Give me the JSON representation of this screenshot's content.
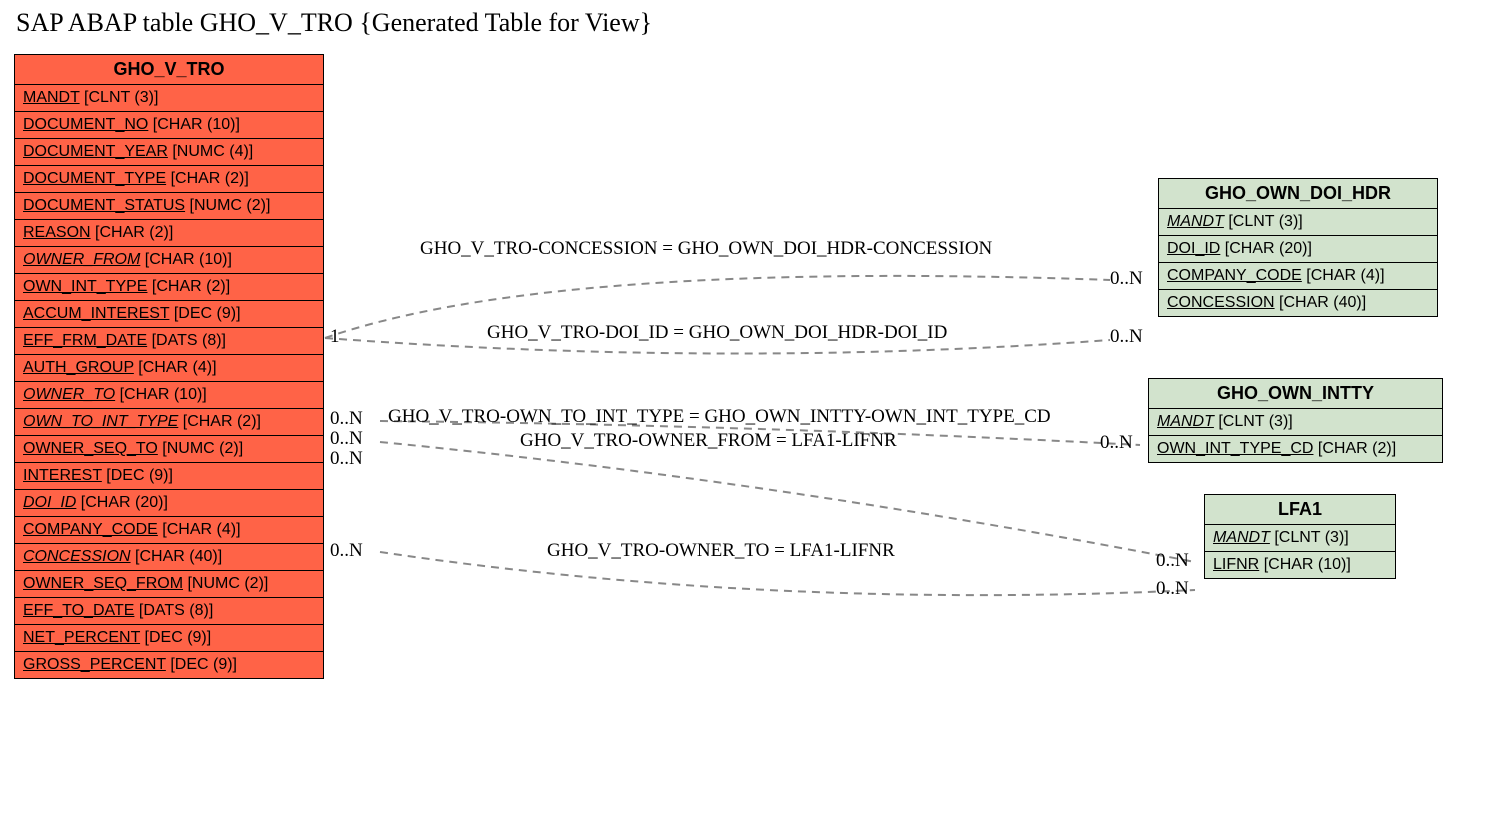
{
  "title": "SAP ABAP table GHO_V_TRO {Generated Table for View}",
  "entities": {
    "main": {
      "name": "GHO_V_TRO",
      "fields": [
        {
          "name": "MANDT",
          "type": "[CLNT (3)]",
          "underline": true,
          "italic": false
        },
        {
          "name": "DOCUMENT_NO",
          "type": "[CHAR (10)]",
          "underline": true,
          "italic": false
        },
        {
          "name": "DOCUMENT_YEAR",
          "type": "[NUMC (4)]",
          "underline": true,
          "italic": false
        },
        {
          "name": "DOCUMENT_TYPE",
          "type": "[CHAR (2)]",
          "underline": true,
          "italic": false
        },
        {
          "name": "DOCUMENT_STATUS",
          "type": "[NUMC (2)]",
          "underline": true,
          "italic": false
        },
        {
          "name": "REASON",
          "type": "[CHAR (2)]",
          "underline": true,
          "italic": false
        },
        {
          "name": "OWNER_FROM",
          "type": "[CHAR (10)]",
          "underline": true,
          "italic": true
        },
        {
          "name": "OWN_INT_TYPE",
          "type": "[CHAR (2)]",
          "underline": true,
          "italic": false
        },
        {
          "name": "ACCUM_INTEREST",
          "type": "[DEC (9)]",
          "underline": true,
          "italic": false
        },
        {
          "name": "EFF_FRM_DATE",
          "type": "[DATS (8)]",
          "underline": true,
          "italic": false
        },
        {
          "name": "AUTH_GROUP",
          "type": "[CHAR (4)]",
          "underline": true,
          "italic": false
        },
        {
          "name": "OWNER_TO",
          "type": "[CHAR (10)]",
          "underline": true,
          "italic": true
        },
        {
          "name": "OWN_TO_INT_TYPE",
          "type": "[CHAR (2)]",
          "underline": true,
          "italic": true
        },
        {
          "name": "OWNER_SEQ_TO",
          "type": "[NUMC (2)]",
          "underline": true,
          "italic": false
        },
        {
          "name": "INTEREST",
          "type": "[DEC (9)]",
          "underline": true,
          "italic": false
        },
        {
          "name": "DOI_ID",
          "type": "[CHAR (20)]",
          "underline": true,
          "italic": true
        },
        {
          "name": "COMPANY_CODE",
          "type": "[CHAR (4)]",
          "underline": true,
          "italic": false
        },
        {
          "name": "CONCESSION",
          "type": "[CHAR (40)]",
          "underline": true,
          "italic": true
        },
        {
          "name": "OWNER_SEQ_FROM",
          "type": "[NUMC (2)]",
          "underline": true,
          "italic": false
        },
        {
          "name": "EFF_TO_DATE",
          "type": "[DATS (8)]",
          "underline": true,
          "italic": false
        },
        {
          "name": "NET_PERCENT",
          "type": "[DEC (9)]",
          "underline": true,
          "italic": false
        },
        {
          "name": "GROSS_PERCENT",
          "type": "[DEC (9)]",
          "underline": true,
          "italic": false
        }
      ]
    },
    "doi_hdr": {
      "name": "GHO_OWN_DOI_HDR",
      "fields": [
        {
          "name": "MANDT",
          "type": "[CLNT (3)]",
          "underline": true,
          "italic": true
        },
        {
          "name": "DOI_ID",
          "type": "[CHAR (20)]",
          "underline": true,
          "italic": false
        },
        {
          "name": "COMPANY_CODE",
          "type": "[CHAR (4)]",
          "underline": true,
          "italic": false
        },
        {
          "name": "CONCESSION",
          "type": "[CHAR (40)]",
          "underline": true,
          "italic": false
        }
      ]
    },
    "intty": {
      "name": "GHO_OWN_INTTY",
      "fields": [
        {
          "name": "MANDT",
          "type": "[CLNT (3)]",
          "underline": true,
          "italic": true
        },
        {
          "name": "OWN_INT_TYPE_CD",
          "type": "[CHAR (2)]",
          "underline": true,
          "italic": false
        }
      ]
    },
    "lfa1": {
      "name": "LFA1",
      "fields": [
        {
          "name": "MANDT",
          "type": "[CLNT (3)]",
          "underline": true,
          "italic": true
        },
        {
          "name": "LIFNR",
          "type": "[CHAR (10)]",
          "underline": true,
          "italic": false
        }
      ]
    }
  },
  "relations": {
    "r1": {
      "label": "GHO_V_TRO-CONCESSION = GHO_OWN_DOI_HDR-CONCESSION",
      "left_card": "",
      "right_card": "0..N"
    },
    "r2": {
      "label": "GHO_V_TRO-DOI_ID = GHO_OWN_DOI_HDR-DOI_ID",
      "left_card": "1",
      "right_card": "0..N"
    },
    "r3": {
      "label": "GHO_V_TRO-OWN_TO_INT_TYPE = GHO_OWN_INTTY-OWN_INT_TYPE_CD",
      "left_card": "0..N",
      "right_card": "0..N"
    },
    "r4": {
      "label": "GHO_V_TRO-OWNER_FROM = LFA1-LIFNR",
      "left_card": "0..N",
      "right_card": ""
    },
    "r5": {
      "label": "GHO_V_TRO-OWNER_TO = LFA1-LIFNR",
      "left_card": "0..N",
      "right_card": "0..N"
    },
    "extra_left_card": "0..N",
    "extra_right_card": "0..N"
  }
}
